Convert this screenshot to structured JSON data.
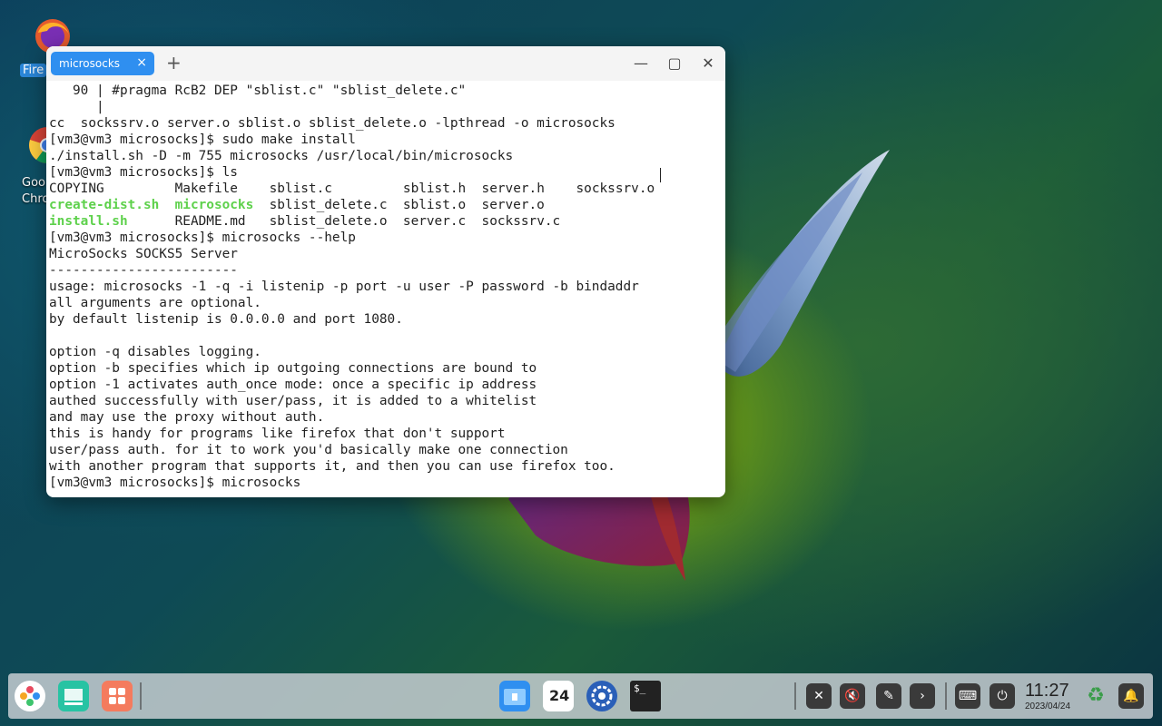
{
  "desktop": {
    "icons": [
      {
        "name": "Firefox",
        "label": "Fire"
      },
      {
        "name": "Google Chrome",
        "label_line1": "Goo",
        "label_line2": "Chro"
      }
    ]
  },
  "terminal": {
    "tab_title": "microsocks",
    "tab_close": "×",
    "new_tab": "+",
    "controls": {
      "minimize": "—",
      "maximize": "▢",
      "close": "✕"
    },
    "lines": [
      "   90 | #pragma RcB2 DEP \"sblist.c\" \"sblist_delete.c\"",
      "      |",
      "cc  sockssrv.o server.o sblist.o sblist_delete.o -lpthread -o microsocks",
      "[vm3@vm3 microsocks]$ sudo make install",
      "./install.sh -D -m 755 microsocks /usr/local/bin/microsocks",
      "[vm3@vm3 microsocks]$ ls",
      "__LS1__",
      "__LS2__",
      "__LS3__",
      "[vm3@vm3 microsocks]$ microsocks --help",
      "MicroSocks SOCKS5 Server",
      "------------------------",
      "usage: microsocks -1 -q -i listenip -p port -u user -P password -b bindaddr",
      "all arguments are optional.",
      "by default listenip is 0.0.0.0 and port 1080.",
      "",
      "option -q disables logging.",
      "option -b specifies which ip outgoing connections are bound to",
      "option -1 activates auth_once mode: once a specific ip address",
      "authed successfully with user/pass, it is added to a whitelist",
      "and may use the proxy without auth.",
      "this is handy for programs like firefox that don't support",
      "user/pass auth. for it to work you'd basically make one connection",
      "with another program that supports it, and then you can use firefox too.",
      "[vm3@vm3 microsocks]$ microsocks"
    ],
    "ls_rows": [
      [
        {
          "t": "COPYING",
          "c": false
        },
        {
          "t": "Makefile",
          "c": false
        },
        {
          "t": "sblist.c",
          "c": false
        },
        {
          "t": "sblist.h",
          "c": false
        },
        {
          "t": "server.h",
          "c": false
        },
        {
          "t": "sockssrv.o",
          "c": false
        }
      ],
      [
        {
          "t": "create-dist.sh",
          "c": true
        },
        {
          "t": "microsocks",
          "c": true
        },
        {
          "t": "sblist_delete.c",
          "c": false
        },
        {
          "t": "sblist.o",
          "c": false
        },
        {
          "t": "server.o",
          "c": false
        }
      ],
      [
        {
          "t": "install.sh",
          "c": true
        },
        {
          "t": "README.md",
          "c": false
        },
        {
          "t": "sblist_delete.o",
          "c": false
        },
        {
          "t": "server.c",
          "c": false
        },
        {
          "t": "sockssrv.c",
          "c": false
        }
      ]
    ]
  },
  "taskbar": {
    "clock_time": "11:27",
    "clock_date": "2023/04/24",
    "calendar_day": "24",
    "terminal_icon_text": "$_"
  },
  "colors": {
    "tab_accent": "#2f8ff0",
    "ls_executable": "#5ed14c"
  }
}
